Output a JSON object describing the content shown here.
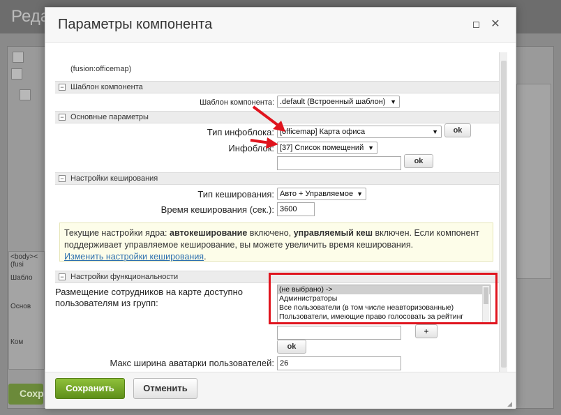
{
  "background": {
    "title": "Реда",
    "green_button": "Сохр",
    "side_text": "<body><",
    "side_items": [
      "(fusi",
      "Шабло",
      "Основ",
      "Ком"
    ]
  },
  "dialog": {
    "title": "Параметры компонента",
    "component_path": "(fusion:officemap)",
    "sections": {
      "template": "Шаблон компонента",
      "basic": "Основные параметры",
      "cache": "Настройки кеширования",
      "func": "Настройки функциональности"
    },
    "template_label": "Шаблон компонента:",
    "template_value": ".default (Встроенный шаблон)",
    "iblock_type_label": "Тип инфоблока:",
    "iblock_type_value": "[officemap] Карта офиса",
    "iblock_label": "Инфоблок:",
    "iblock_value": "[37] Список помещений",
    "ok_label": "ok",
    "cache_type_label": "Тип кеширования:",
    "cache_type_value": "Авто + Управляемое",
    "cache_time_label": "Время кеширования (сек.):",
    "cache_time_value": "3600",
    "note": {
      "part1": "Текущие настройки ядра: ",
      "bold1": "автокеширование",
      "part2": " включено, ",
      "bold2": "управляемый кеш",
      "part3": " включен. Если компонент поддерживает управляемое кеширование, вы можете увеличить время кеширования.",
      "link": "Изменить настройки кеширования",
      "end": "."
    },
    "groups_label_line1": "Размещение сотрудников на карте доступно",
    "groups_label_line2": "пользователям из групп:",
    "groups_options": [
      "(не выбрано) ->",
      "Администраторы",
      "Все пользователи (в том числе неавторизованные)",
      "Пользователи, имеющие право голосовать за рейтинг"
    ],
    "plus_label": "+",
    "avatar_label": "Макс ширина аватарки пользователей:",
    "avatar_value": "26",
    "save_label": "Сохранить",
    "cancel_label": "Отменить",
    "close_glyph": "✕",
    "highlight_color": "#e0141e"
  }
}
